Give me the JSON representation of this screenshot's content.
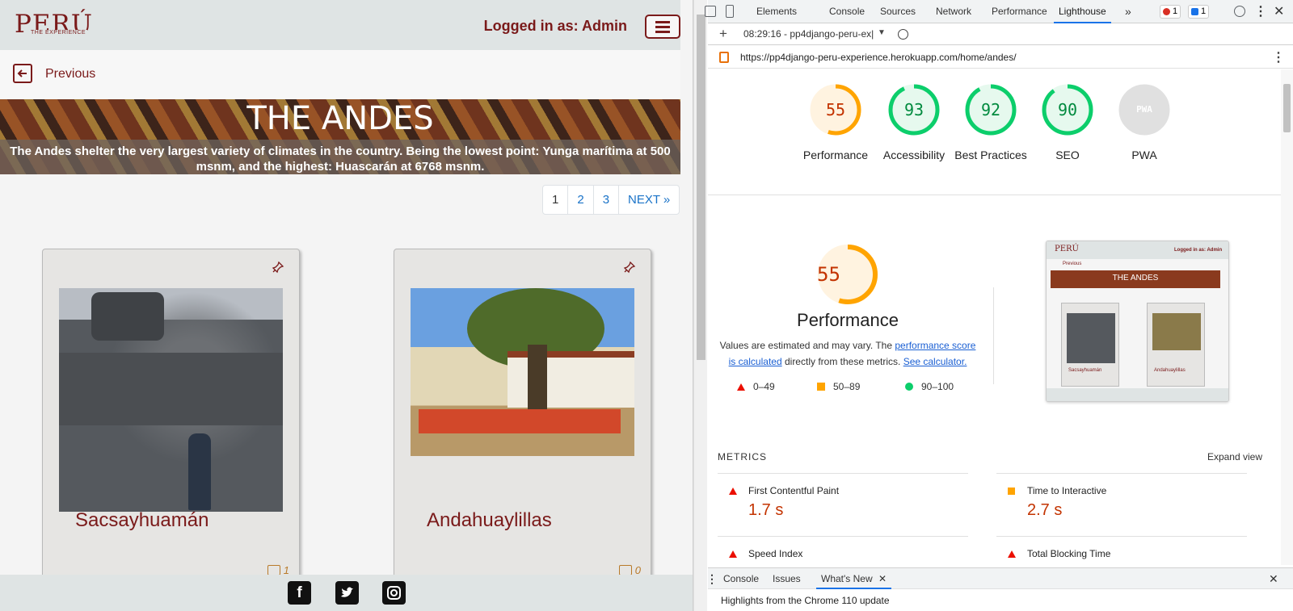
{
  "site": {
    "logo_main": "PERÚ",
    "logo_sub": "THE EXPERIENCE",
    "login_text": "Logged in as: Admin",
    "previous_label": "Previous",
    "hero_title": "THE ANDES",
    "hero_description": "The Andes shelter the very largest variety of climates in the country. Being the lowest point: Yunga marítima at 500 msnm, and the highest: Huascarán at 6768 msnm.",
    "pagination": [
      "1",
      "2",
      "3",
      "NEXT »"
    ],
    "cards": [
      {
        "title": "Sacsayhuamán",
        "comments": "1"
      },
      {
        "title": "Andahuaylillas",
        "comments": "0"
      }
    ],
    "footer_icons": [
      "facebook-icon",
      "twitter-icon",
      "instagram-icon"
    ]
  },
  "devtools": {
    "tabs": [
      "Elements",
      "Console",
      "Sources",
      "Network",
      "Performance",
      "Lighthouse"
    ],
    "more_tabs": "»",
    "error_count": "1",
    "message_count": "1",
    "report_time": "08:29:16 - pp4django-peru-ex|",
    "url": "https://pp4django-peru-experience.herokuapp.com/home/andes/",
    "scores": [
      {
        "label": "Performance",
        "value": "55",
        "color": "#ffa400"
      },
      {
        "label": "Accessibility",
        "value": "93",
        "color": "#0cce6b"
      },
      {
        "label": "Best Practices",
        "value": "92",
        "color": "#0cce6b"
      },
      {
        "label": "SEO",
        "value": "90",
        "color": "#0cce6b"
      },
      {
        "label": "PWA",
        "value": "PWA",
        "color": "#9e9e9e"
      }
    ],
    "perf_score": "55",
    "perf_heading": "Performance",
    "perf_note_1": "Values are estimated and may vary. The ",
    "perf_note_link1": "performance score is calculated",
    "perf_note_2": " directly from these metrics. ",
    "perf_note_link2": "See calculator.",
    "legend": [
      "0–49",
      "50–89",
      "90–100"
    ],
    "thumb": {
      "title": "THE ANDES",
      "login": "Logged in as: Admin",
      "card1": "Sacsayhuamán",
      "card2": "Andahuaylillas",
      "previous": "Previous"
    },
    "metrics_heading": "METRICS",
    "expand_view": "Expand view",
    "metrics": [
      {
        "label": "First Contentful Paint",
        "value": "1.7 s",
        "status": "bad"
      },
      {
        "label": "Time to Interactive",
        "value": "2.7 s",
        "status": "average"
      },
      {
        "label": "Speed Index",
        "value": "",
        "status": "bad"
      },
      {
        "label": "Total Blocking Time",
        "value": "",
        "status": "bad"
      }
    ],
    "drawer_tabs": [
      "Console",
      "Issues",
      "What's New"
    ],
    "drawer_text": "Highlights from the Chrome 110 update"
  }
}
